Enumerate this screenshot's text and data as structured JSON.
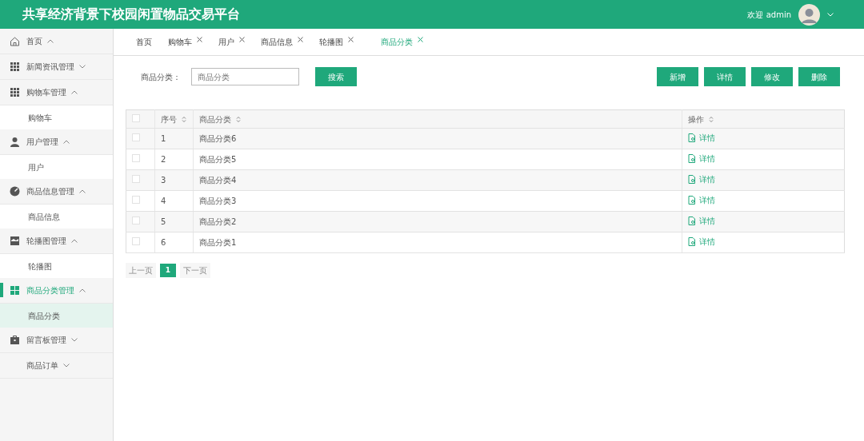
{
  "header": {
    "title": "共享经济背景下校园闲置物品交易平台",
    "welcome": "欢迎 admin"
  },
  "sidebar": {
    "items": [
      {
        "label": "首页",
        "expanded": true,
        "selected": false
      },
      {
        "label": "新闻资讯管理",
        "expanded": false,
        "selected": false
      },
      {
        "label": "购物车管理",
        "expanded": true,
        "selected": false,
        "children": [
          {
            "label": "购物车",
            "selected": false
          }
        ]
      },
      {
        "label": "用户管理",
        "expanded": true,
        "selected": false,
        "children": [
          {
            "label": "用户",
            "selected": false
          }
        ]
      },
      {
        "label": "商品信息管理",
        "expanded": true,
        "selected": false,
        "children": [
          {
            "label": "商品信息",
            "selected": false
          }
        ]
      },
      {
        "label": "轮播图管理",
        "expanded": true,
        "selected": false,
        "children": [
          {
            "label": "轮播图",
            "selected": false
          }
        ]
      },
      {
        "label": "商品分类管理",
        "expanded": true,
        "selected": true,
        "children": [
          {
            "label": "商品分类",
            "selected": true
          }
        ]
      },
      {
        "label": "留言板管理",
        "expanded": false,
        "selected": false
      },
      {
        "label": "商品订单",
        "expanded": false,
        "selected": false
      }
    ]
  },
  "tabs": [
    {
      "label": "首页",
      "closable": false,
      "selected": false
    },
    {
      "label": "购物车",
      "closable": true,
      "selected": false
    },
    {
      "label": "用户",
      "closable": true,
      "selected": false
    },
    {
      "label": "商品信息",
      "closable": true,
      "selected": false
    },
    {
      "label": "轮播图",
      "closable": true,
      "selected": false
    },
    {
      "label": "商品分类",
      "closable": true,
      "selected": true
    }
  ],
  "search": {
    "label": "商品分类：",
    "placeholder": "商品分类",
    "button": "搜索"
  },
  "actions": [
    "新增",
    "详情",
    "修改",
    "删除"
  ],
  "table": {
    "all_checked": false,
    "columns": [
      "序号",
      "商品分类",
      "操作"
    ],
    "rows": [
      {
        "index": "1",
        "name": "商品分类6",
        "action": "详情",
        "checked": false
      },
      {
        "index": "2",
        "name": "商品分类5",
        "action": "详情",
        "checked": false
      },
      {
        "index": "3",
        "name": "商品分类4",
        "action": "详情",
        "checked": false
      },
      {
        "index": "4",
        "name": "商品分类3",
        "action": "详情",
        "checked": false
      },
      {
        "index": "5",
        "name": "商品分类2",
        "action": "详情",
        "checked": false
      },
      {
        "index": "6",
        "name": "商品分类1",
        "action": "详情",
        "checked": false
      }
    ]
  },
  "pagination": {
    "prev": "上一页",
    "pages": [
      {
        "label": "1",
        "selected": true
      }
    ],
    "next": "下一页"
  }
}
